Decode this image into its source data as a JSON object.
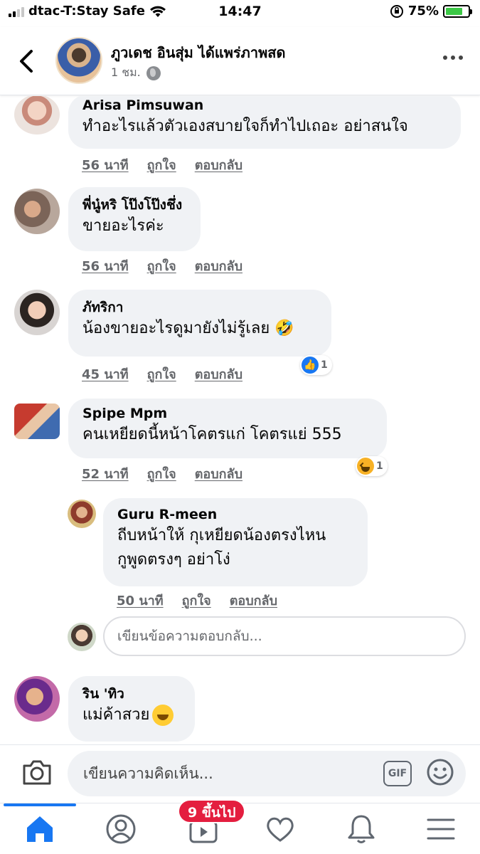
{
  "status_bar": {
    "carrier": "dtac-T:Stay Safe",
    "time": "14:47",
    "battery": "75%",
    "battery_level": 0.75
  },
  "header": {
    "name": "ภูวเดช อินสุ่ม ได้แพร่ภาพสด",
    "time": "1 ชม.",
    "back_icon": "chevron-left-icon",
    "more_icon": "more-dots-icon"
  },
  "comments": [
    {
      "name": "Arisa Pimsuwan",
      "text": "ทำอะไรแล้วตัวเองสบายใจก็ทำไปเถอะ อย่าสนใจ",
      "time": "56 นาที",
      "like": "ถูกใจ",
      "reply": "ตอบกลับ"
    },
    {
      "name": "พี่นู๋หริ โป๊งโป๊งชึ่ง",
      "text": "ขายอะไรค่ะ",
      "time": "56 นาที",
      "like": "ถูกใจ",
      "reply": "ตอบกลับ"
    },
    {
      "name": "ภัทริกา",
      "text": "น้องขายอะไรดูมายังไม่รู้เลย 🤣",
      "time": "45 นาที",
      "like": "ถูกใจ",
      "reply": "ตอบกลับ",
      "reaction_count": "1",
      "reaction_icon": "like-reaction-icon"
    },
    {
      "name": "Spipe Mpm",
      "text": "คนเหยียดนี้หน้าโคตรแก่ โคตรแย่ 555",
      "time": "52 นาที",
      "like": "ถูกใจ",
      "reply": "ตอบกลับ",
      "reaction_count": "1",
      "reaction_icon": "haha-reaction-icon"
    },
    {
      "name": "Guru R-meen",
      "text_line1": "ถีบหน้าให้ กุเหยียดน้องตรงไหน",
      "text_line2": "กูพูดตรงๆ อย่าโง่",
      "time": "50 นาที",
      "like": "ถูกใจ",
      "reply": "ตอบกลับ"
    },
    {
      "name": "ริน 'ทิว",
      "text": "แม่ค้าสวย",
      "emoji_icon": "grinning-emoji-icon"
    }
  ],
  "reply_input": {
    "placeholder": "เขียนข้อความตอบกลับ..."
  },
  "composer": {
    "placeholder": "เขียนความคิดเห็น...",
    "gif_label": "GIF",
    "camera_icon": "camera-icon",
    "smile_icon": "smiley-icon"
  },
  "tabbar": {
    "badge": "9 ขึ้นไป",
    "icons": [
      "home-icon",
      "profile-icon",
      "watch-icon",
      "dating-heart-icon",
      "notifications-bell-icon",
      "menu-icon"
    ]
  },
  "colors": {
    "accent": "#1877f2",
    "bubble": "#f0f2f5",
    "meta_text": "#65676b",
    "badge": "#e41e3f"
  }
}
